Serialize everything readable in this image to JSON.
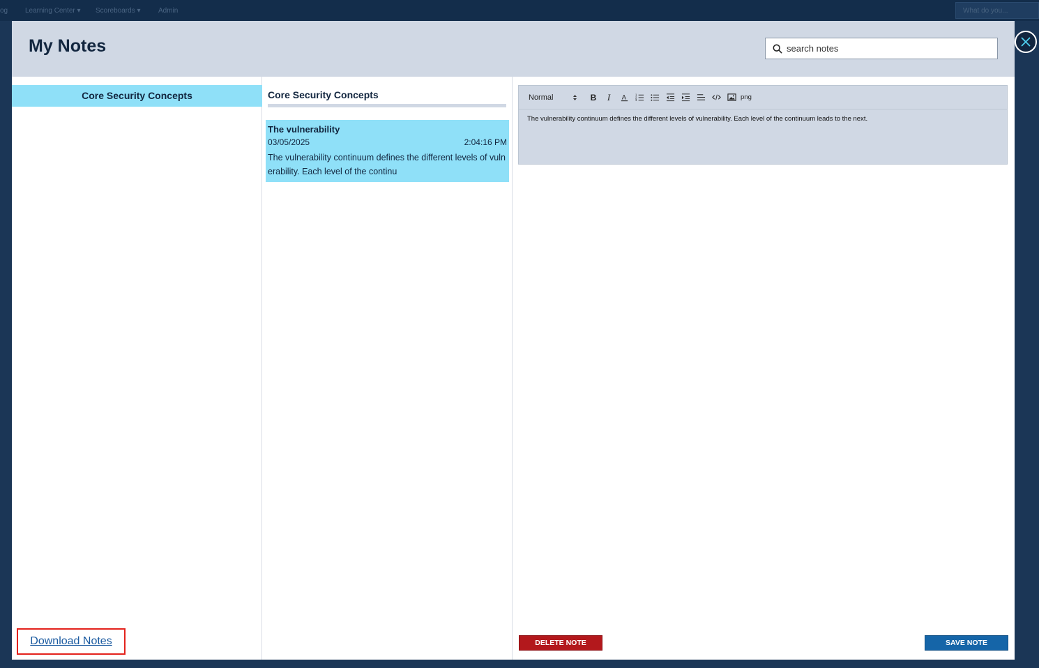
{
  "background_nav": {
    "items": [
      "og",
      "Learning Center ▾",
      "Scoreboards ▾",
      "Admin"
    ],
    "search_text": "What do you..."
  },
  "modal": {
    "title": "My Notes",
    "search": {
      "placeholder": "search notes",
      "value": ""
    },
    "categories": [
      {
        "label": "Core Security Concepts",
        "selected": true
      }
    ],
    "download_label": "Download Notes",
    "notes_panel": {
      "title": "Core Security Concepts",
      "notes": [
        {
          "title": "The vulnerability",
          "date": "03/05/2025",
          "time": "2:04:16 PM",
          "snippet": "The vulnerability continuum defines the different levels of vulnerability. Each level of the continu"
        }
      ]
    },
    "editor": {
      "format_value": "Normal",
      "toolbar_icons": [
        "bold-icon",
        "italic-icon",
        "font-color-icon",
        "ordered-list-icon",
        "bullet-list-icon",
        "outdent-icon",
        "indent-icon",
        "align-icon",
        "code-icon",
        "image-icon"
      ],
      "png_label": "png",
      "content": "The vulnerability continuum defines the different levels of vulnerability. Each level of the continuum leads to the next."
    },
    "delete_label": "DELETE NOTE",
    "save_label": "SAVE NOTE"
  },
  "colors": {
    "header_bg": "#d0d8e4",
    "selected_bg": "#8fe0f8",
    "delete_red": "#b3181c",
    "save_blue": "#1565a8",
    "highlight_border": "#e3221c"
  }
}
